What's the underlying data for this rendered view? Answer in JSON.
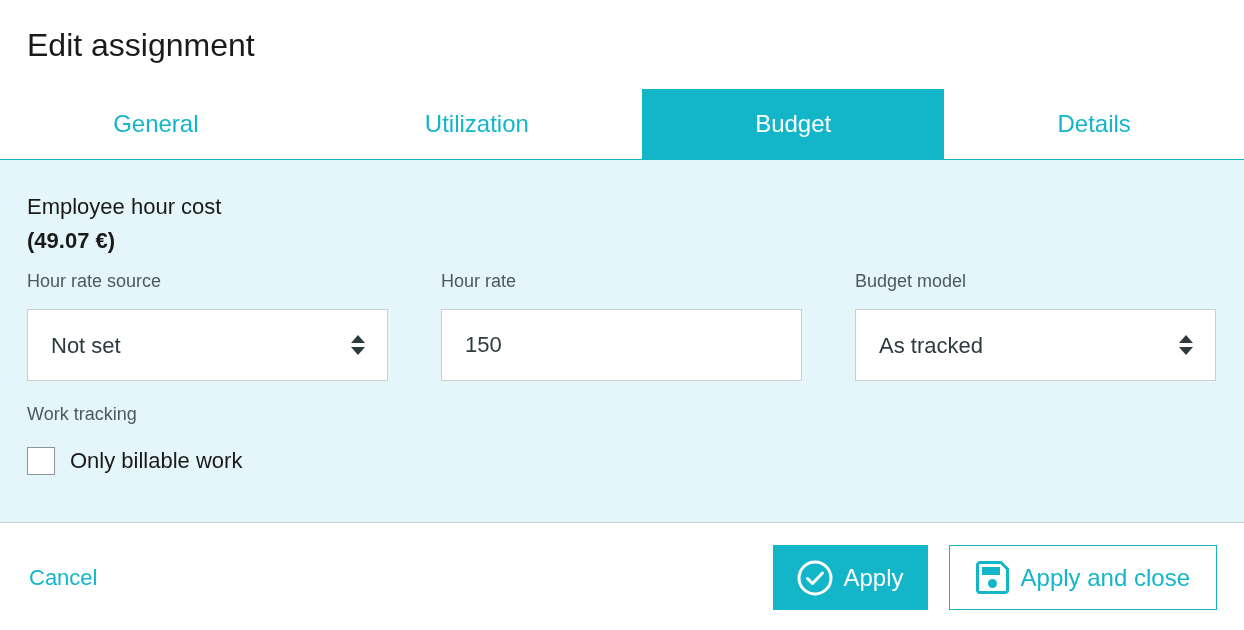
{
  "dialog": {
    "title": "Edit assignment"
  },
  "tabs": [
    {
      "label": "General",
      "selected": false
    },
    {
      "label": "Utilization",
      "selected": false
    },
    {
      "label": "Budget",
      "selected": true
    },
    {
      "label": "Details",
      "selected": false
    }
  ],
  "cost": {
    "label": "Employee hour cost",
    "value": "(49.07 €)"
  },
  "fields": [
    {
      "kind": "select",
      "label": "Hour rate source",
      "value": "Not set"
    },
    {
      "kind": "input",
      "label": "Hour rate",
      "value": "150"
    },
    {
      "kind": "select",
      "label": "Budget model",
      "value": "As tracked"
    }
  ],
  "work_tracking": {
    "label": "Work tracking",
    "options": [
      {
        "label": "Only billable work",
        "checked": false
      }
    ]
  },
  "footer": {
    "cancel": "Cancel",
    "buttons": [
      {
        "kind": "primary",
        "label": "Apply"
      },
      {
        "kind": "secondary",
        "label": "Apply and close"
      }
    ]
  }
}
